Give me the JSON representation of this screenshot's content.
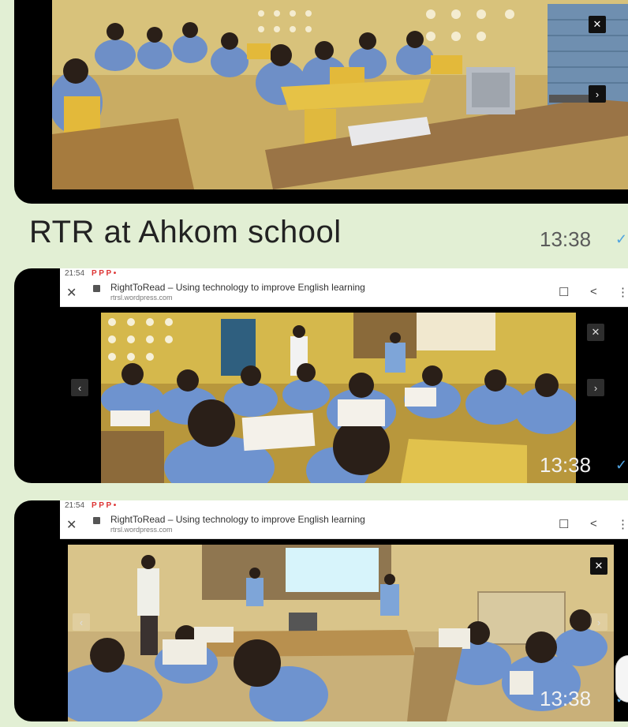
{
  "messages": [
    {
      "caption": "RTR at Ahkom school",
      "time": "13:38"
    },
    {
      "time": "13:38"
    },
    {
      "time": "13:38"
    }
  ],
  "browser": {
    "status_time": "21:54",
    "status_indicators": "P P P •",
    "page_title": "RightToRead – Using technology to improve English learning",
    "host": "rtrsl.wordpress.com"
  },
  "icons": {
    "close": "✕",
    "prev": "‹",
    "next": "›",
    "bookmark": "☐",
    "share": "<",
    "more": "⋮",
    "tick": "✓"
  },
  "colors": {
    "bubble": "#e2efd4",
    "background": "#dfe9d3",
    "tick": "#4fa3e0"
  }
}
